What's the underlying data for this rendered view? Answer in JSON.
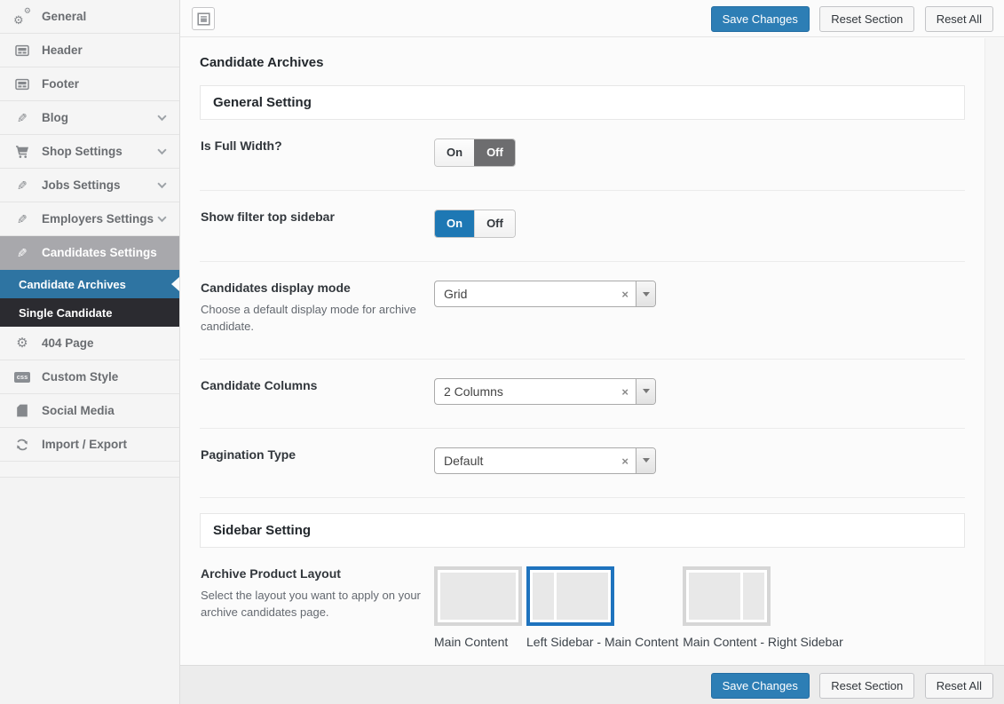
{
  "colors": {
    "primary_button_blue": "#2d7eb5",
    "toggle_on_blue": "#1e78b4",
    "toggle_off_gray": "#6d6d6f",
    "sidebar_current_blue": "#2e74a2",
    "sidebar_current_dark": "#2b2b30",
    "sidebar_active_gray": "#a8a8ac",
    "selected_layout_border": "#1e73be"
  },
  "toolbar": {
    "save_label": "Save Changes",
    "reset_section_label": "Reset Section",
    "reset_all_label": "Reset All"
  },
  "page": {
    "title": "Candidate Archives"
  },
  "sidebar": {
    "items": [
      {
        "label": "General",
        "icon": "gears-icon",
        "chevron": false
      },
      {
        "label": "Header",
        "icon": "panel-icon",
        "chevron": false
      },
      {
        "label": "Footer",
        "icon": "panel-icon",
        "chevron": false
      },
      {
        "label": "Blog",
        "icon": "pencil-icon",
        "chevron": true
      },
      {
        "label": "Shop Settings",
        "icon": "cart-icon",
        "chevron": true
      },
      {
        "label": "Jobs Settings",
        "icon": "pencil-icon",
        "chevron": true
      },
      {
        "label": "Employers Settings",
        "icon": "pencil-icon",
        "chevron": true
      },
      {
        "label": "Candidates Settings",
        "icon": "pencil-icon",
        "chevron": false,
        "state": "active"
      },
      {
        "label": "404 Page",
        "icon": "gear-icon",
        "chevron": false
      },
      {
        "label": "Custom Style",
        "icon": "css-icon",
        "chevron": false
      },
      {
        "label": "Social Media",
        "icon": "page-icon",
        "chevron": false
      },
      {
        "label": "Import / Export",
        "icon": "sync-icon",
        "chevron": false
      }
    ],
    "submenu": [
      {
        "label": "Candidate Archives",
        "state": "current"
      },
      {
        "label": "Single Candidate",
        "state": "dark"
      }
    ],
    "css_badge_text": "css"
  },
  "sections": {
    "general": "General Setting",
    "sidebar": "Sidebar Setting"
  },
  "toggle": {
    "on": "On",
    "off": "Off"
  },
  "select": {
    "clear_glyph": "×"
  },
  "fields": {
    "full_width": {
      "label": "Is Full Width?",
      "selected": "Off"
    },
    "filter_top_sidebar": {
      "label": "Show filter top sidebar",
      "selected": "On"
    },
    "display_mode": {
      "label": "Candidates display mode",
      "description": "Choose a default display mode for archive candidate.",
      "value": "Grid"
    },
    "candidate_columns": {
      "label": "Candidate Columns",
      "value": "2 Columns"
    },
    "pagination_type": {
      "label": "Pagination Type",
      "value": "Default"
    },
    "archive_layout": {
      "label": "Archive Product Layout",
      "description": "Select the layout you want to apply on your archive candidates page.",
      "options": [
        {
          "label": "Main Content",
          "selected": false
        },
        {
          "label": "Left Sidebar - Main Content",
          "selected": true
        },
        {
          "label": "Main Content - Right Sidebar",
          "selected": false
        }
      ]
    }
  }
}
